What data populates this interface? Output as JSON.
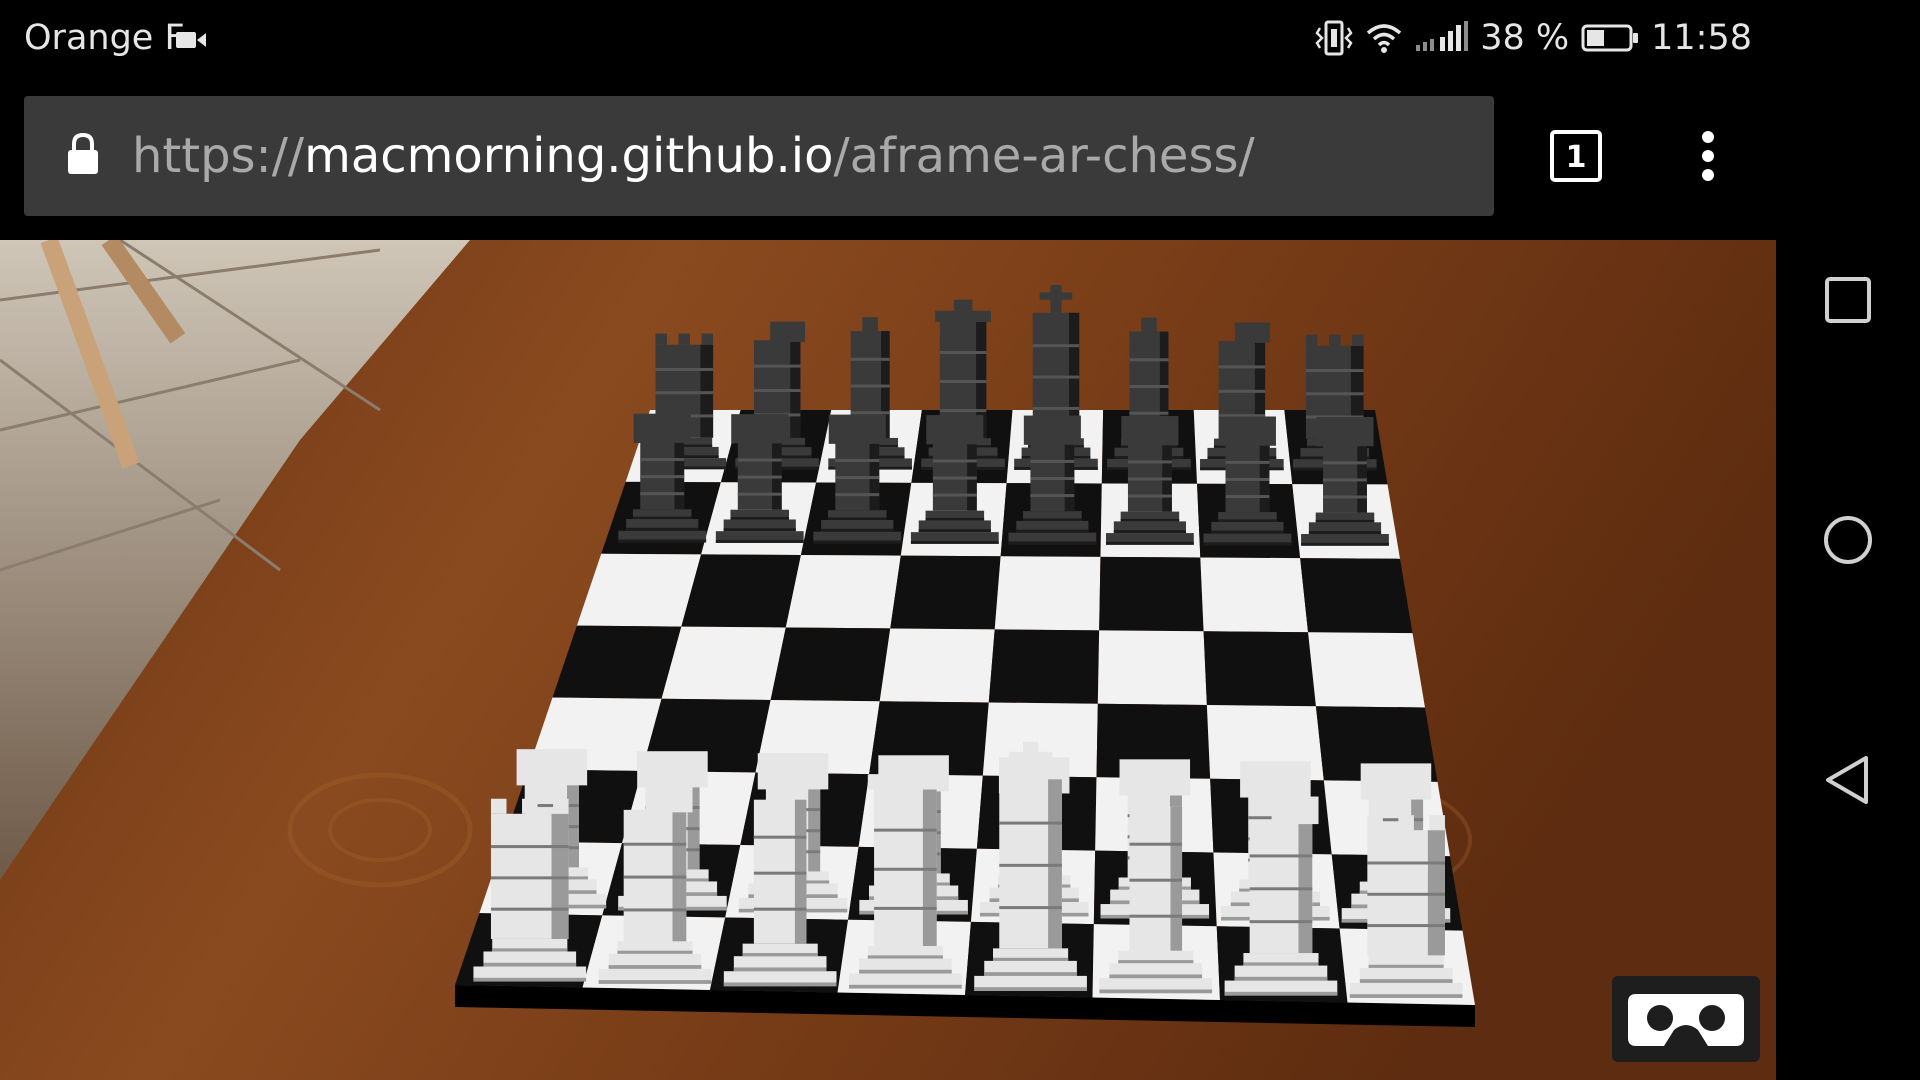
{
  "status_bar": {
    "carrier": "Orange F",
    "battery_percent": "38 %",
    "time": "11:58",
    "icons": [
      "video-call-icon",
      "vibrate-icon",
      "wifi-icon",
      "signal-icon",
      "battery-icon"
    ]
  },
  "browser": {
    "url_scheme": "https://",
    "url_host": "macmorning.github.io",
    "url_path": "/aframe-ar-chess/",
    "tab_count": "1",
    "icons": [
      "lock-icon",
      "tabs-icon",
      "overflow-menu-icon"
    ]
  },
  "navigation_bar": {
    "icons": [
      "recent-apps-icon",
      "home-icon",
      "back-icon"
    ]
  },
  "scene": {
    "board": {
      "files": 8,
      "ranks": 8
    },
    "pieces": {
      "black_back_rank": [
        "rook",
        "knight",
        "bishop",
        "queen",
        "king",
        "bishop",
        "knight",
        "rook"
      ],
      "black_pawns": [
        "pawn",
        "pawn",
        "pawn",
        "pawn",
        "pawn",
        "pawn",
        "pawn",
        "pawn"
      ],
      "white_pawns": [
        "pawn",
        "pawn",
        "pawn",
        "pawn",
        "pawn",
        "pawn",
        "pawn",
        "pawn"
      ],
      "white_back_rank": [
        "rook",
        "knight",
        "bishop",
        "queen",
        "king",
        "bishop",
        "knight",
        "rook"
      ]
    },
    "vr_button_icon": "cardboard-vr-icon"
  },
  "colors": {
    "table_wood": "#6b3414",
    "board_light": "#f2f2f2",
    "board_dark": "#101010",
    "black_piece": "#3a3a3a",
    "white_piece": "#e6e6e6",
    "url_bar": "#3a3a3a"
  }
}
